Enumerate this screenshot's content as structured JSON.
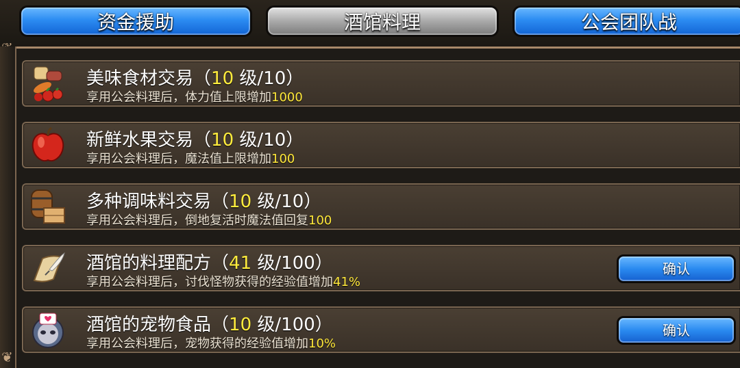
{
  "tabs": [
    {
      "label": "资金援助"
    },
    {
      "label": "酒馆料理"
    },
    {
      "label": "公会团队战"
    }
  ],
  "items": [
    {
      "name": "美味食材交易",
      "level": "10",
      "unit": "级",
      "max": "/10",
      "desc": "享用公会料理后，体力值上限增加",
      "value": "1000",
      "icon": "food-ingredients-icon"
    },
    {
      "name": "新鲜水果交易",
      "level": "10",
      "unit": "级",
      "max": "/10",
      "desc": "享用公会料理后，魔法值上限增加",
      "value": "100",
      "icon": "apple-icon"
    },
    {
      "name": "多种调味料交易",
      "level": "10",
      "unit": "级",
      "max": "/10",
      "desc": "享用公会料理后，倒地复活时魔法值回复",
      "value": "100",
      "icon": "barrel-crate-icon"
    },
    {
      "name": "酒馆的料理配方",
      "level": "41",
      "unit": "级",
      "max": "/100",
      "desc": "享用公会料理后，讨伐怪物获得的经验值增加",
      "value": "41%",
      "icon": "scroll-quill-icon",
      "button": "确认"
    },
    {
      "name": "酒馆的宠物食品",
      "level": "10",
      "unit": "级",
      "max": "/100",
      "desc": "享用公会料理后，宠物获得的经验值增加",
      "value": "10%",
      "icon": "pet-food-icon",
      "button": "确认"
    }
  ],
  "colors": {
    "accent_blue": "#2c8cf2",
    "level_yellow": "#ffec3d",
    "panel": "#3a3128"
  }
}
